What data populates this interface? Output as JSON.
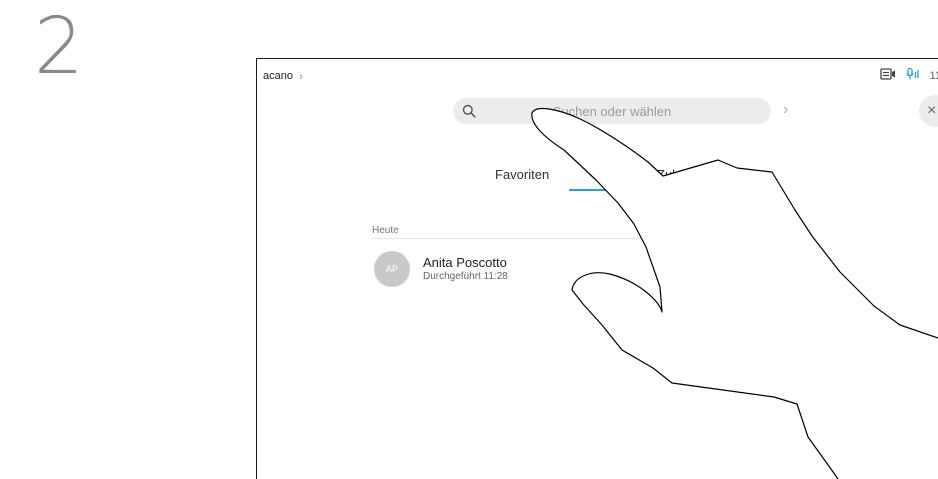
{
  "step": {
    "number": "2"
  },
  "header": {
    "breadcrumb": "acano",
    "breadcrumb_chevron": "›",
    "time": "11:",
    "icons": [
      "video-layout-icon",
      "microphone-icon"
    ]
  },
  "search": {
    "placeholder": "Suchen oder wählen",
    "go_glyph": "›",
    "close_glyph": "×"
  },
  "tabs": [
    {
      "label": "Favoriten"
    },
    {
      "label": "Zuletzt",
      "active": true
    }
  ],
  "recents": {
    "section_label": "Heute",
    "items": [
      {
        "initials": "AP",
        "name": "Anita Poscotto",
        "subtitle": "Durchgeführt 11:28"
      }
    ]
  },
  "colors": {
    "accent": "#20a3d8",
    "avatar_bg": "#c9c9c9",
    "search_bg": "#ececec"
  }
}
